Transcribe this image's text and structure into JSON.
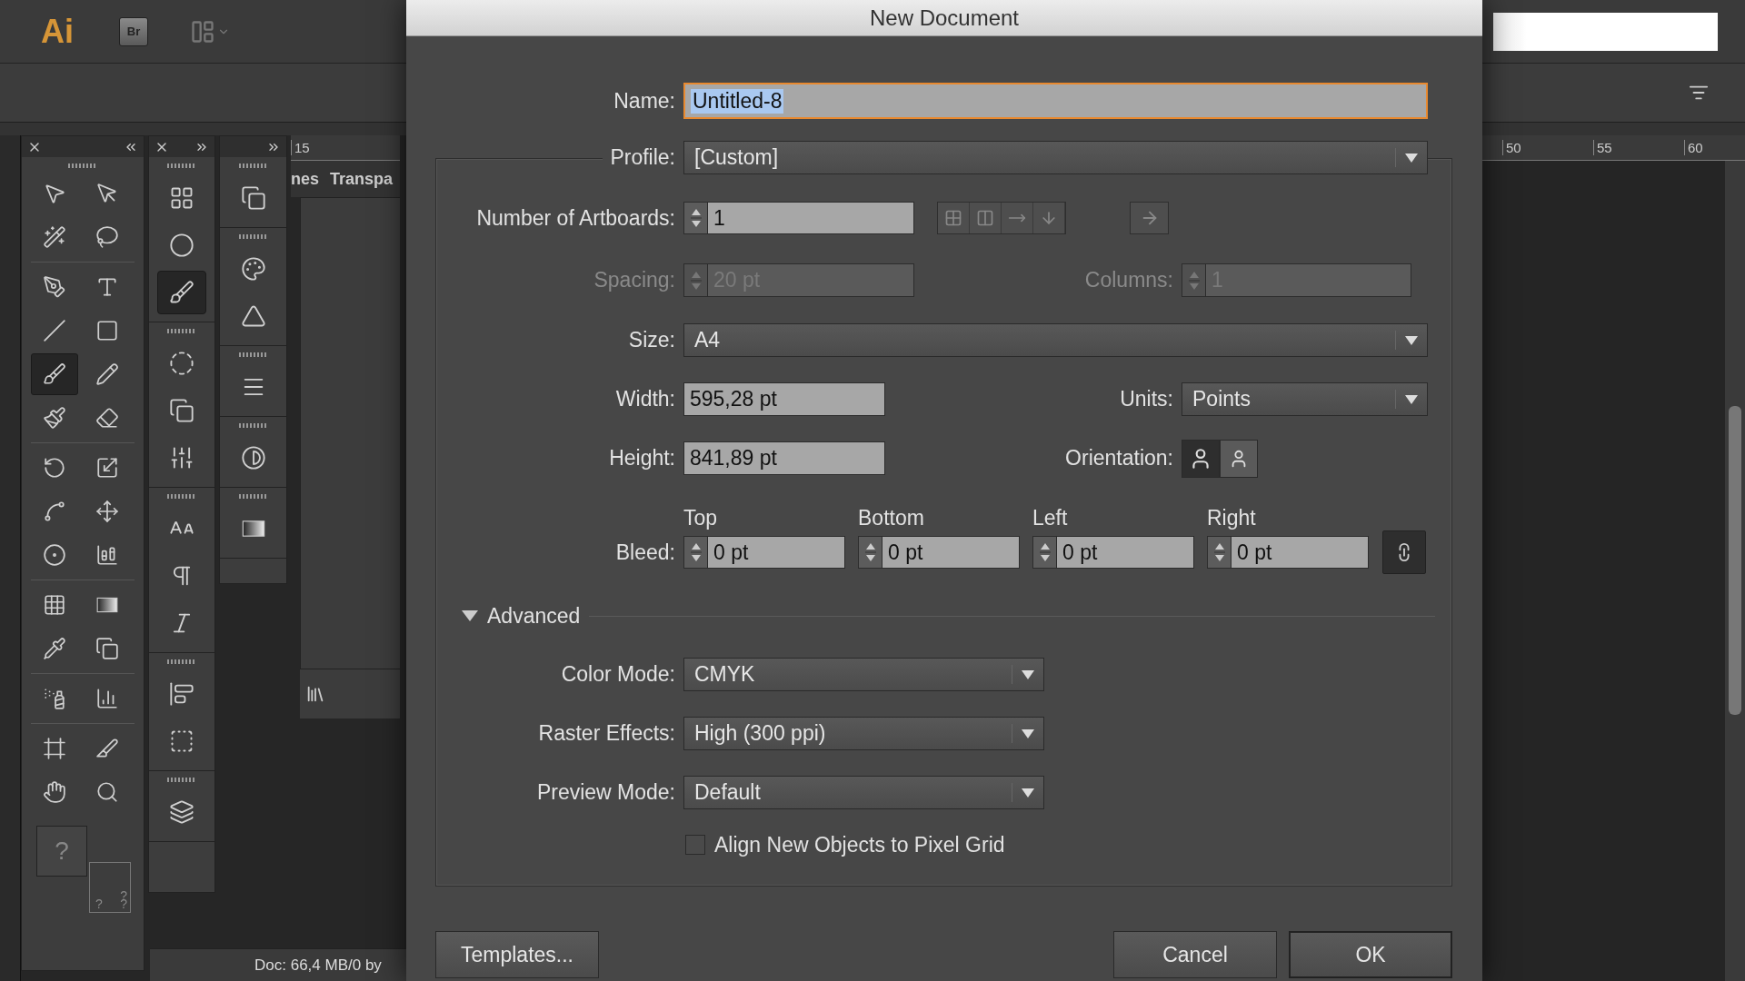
{
  "app": {
    "logo": "Ai",
    "bridge_button": "Br"
  },
  "tool_panel": {
    "tools": [
      {
        "kind": "selection",
        "selected": false
      },
      {
        "kind": "direct",
        "selected": false
      },
      {
        "kind": "wand",
        "selected": false
      },
      {
        "kind": "lasso",
        "selected": false
      },
      {
        "kind": "pen",
        "selected": false
      },
      {
        "kind": "type",
        "selected": false
      },
      {
        "kind": "line",
        "selected": false
      },
      {
        "kind": "rect",
        "selected": false
      },
      {
        "kind": "brush",
        "selected": true
      },
      {
        "kind": "pencil",
        "selected": false
      },
      {
        "kind": "blob",
        "selected": false
      },
      {
        "kind": "eraser",
        "selected": false
      },
      {
        "kind": "rotate",
        "selected": false
      },
      {
        "kind": "scale",
        "selected": false
      },
      {
        "kind": "warp",
        "selected": false
      },
      {
        "kind": "transform",
        "selected": false
      },
      {
        "kind": "shapebuilder",
        "selected": false
      },
      {
        "kind": "graph",
        "selected": false
      },
      {
        "kind": "mesh",
        "selected": false
      },
      {
        "kind": "gradient",
        "selected": false
      },
      {
        "kind": "eyedropper",
        "selected": false
      },
      {
        "kind": "blend",
        "selected": false
      },
      {
        "kind": "sprayer",
        "selected": false
      },
      {
        "kind": "column",
        "selected": false
      },
      {
        "kind": "artboard",
        "selected": false
      },
      {
        "kind": "slice",
        "selected": false
      },
      {
        "kind": "hand",
        "selected": false
      },
      {
        "kind": "zoom",
        "selected": false
      }
    ],
    "fill_mark": "?",
    "stroke_marks": [
      "?",
      "?",
      "?"
    ]
  },
  "dock_panels": [
    {
      "groups": [
        {
          "items": [
            {
              "kind": "grid",
              "selected": false
            },
            {
              "kind": "circles",
              "selected": false
            },
            {
              "kind": "brushes",
              "selected": true
            }
          ]
        },
        {
          "items": [
            {
              "kind": "symbols",
              "selected": false
            },
            {
              "kind": "transformpanel",
              "selected": false
            },
            {
              "kind": "alignbars",
              "selected": false
            }
          ]
        },
        {
          "items": [
            {
              "kind": "character",
              "selected": false
            },
            {
              "kind": "paragraph",
              "selected": false
            },
            {
              "kind": "opentype",
              "selected": false
            }
          ]
        },
        {
          "items": [
            {
              "kind": "alignleft",
              "selected": false
            },
            {
              "kind": "bounds",
              "selected": false
            }
          ]
        },
        {
          "items": [
            {
              "kind": "layers",
              "selected": false
            }
          ]
        }
      ]
    },
    {
      "groups": [
        {
          "items": [
            {
              "kind": "pathfinder",
              "selected": false
            }
          ]
        },
        {
          "items": [
            {
              "kind": "palette",
              "selected": false
            },
            {
              "kind": "swatch",
              "selected": false
            }
          ]
        },
        {
          "items": [
            {
              "kind": "stroke",
              "selected": false
            }
          ]
        },
        {
          "items": [
            {
              "kind": "transparency",
              "selected": false
            }
          ]
        },
        {
          "items": [
            {
              "kind": "gradientpanel",
              "selected": false
            }
          ]
        }
      ]
    }
  ],
  "document_panel": {
    "ruler_label": "15",
    "tabs": [
      "nes",
      "Transpa"
    ]
  },
  "canvas": {
    "ruler_labels": [
      "50",
      "55",
      "60"
    ]
  },
  "status_bar": {
    "text": "Doc: 66,4 MB/0 by"
  },
  "dialog": {
    "title": "New Document",
    "name": {
      "label": "Name:",
      "value": "Untitled-8",
      "focused": true
    },
    "profile": {
      "label": "Profile:",
      "value": "[Custom]"
    },
    "artboards": {
      "label": "Number of Artboards:",
      "value": "1"
    },
    "spacing": {
      "label": "Spacing:",
      "value": "20 pt",
      "disabled": true
    },
    "columns": {
      "label": "Columns:",
      "value": "1",
      "disabled": true
    },
    "size": {
      "label": "Size:",
      "value": "A4"
    },
    "width": {
      "label": "Width:",
      "value": "595,28 pt"
    },
    "units": {
      "label": "Units:",
      "value": "Points"
    },
    "height": {
      "label": "Height:",
      "value": "841,89 pt"
    },
    "orientation": {
      "label": "Orientation:",
      "options": [
        {
          "kind": "portrait",
          "selected": true
        },
        {
          "kind": "landscape",
          "selected": false
        }
      ]
    },
    "bleed": {
      "label": "Bleed:",
      "linked": true,
      "fields": [
        {
          "label": "Top",
          "value": "0 pt"
        },
        {
          "label": "Bottom",
          "value": "0 pt"
        },
        {
          "label": "Left",
          "value": "0 pt"
        },
        {
          "label": "Right",
          "value": "0 pt"
        }
      ]
    },
    "advanced": {
      "label": "Advanced",
      "expanded": true,
      "color_mode": {
        "label": "Color Mode:",
        "value": "CMYK"
      },
      "raster_effects": {
        "label": "Raster Effects:",
        "value": "High (300 ppi)"
      },
      "preview_mode": {
        "label": "Preview Mode:",
        "value": "Default"
      },
      "align_pixel_grid": {
        "label": "Align New Objects to Pixel Grid",
        "checked": false
      }
    },
    "buttons": [
      {
        "label": "Templates...",
        "default": false
      },
      {
        "label": "Cancel",
        "default": false
      },
      {
        "label": "OK",
        "default": true
      }
    ]
  }
}
